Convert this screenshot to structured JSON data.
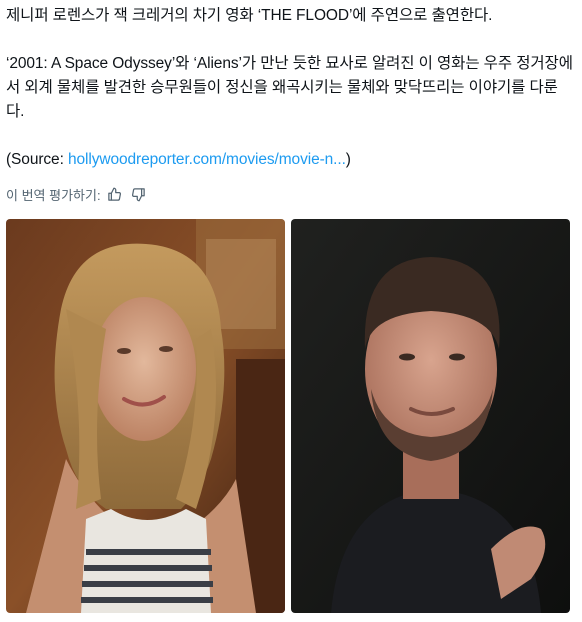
{
  "post": {
    "line1": "제니퍼 로렌스가 잭 크레거의 차기 영화 ‘THE FLOOD’에 주연으로 출연한다.",
    "line2": "‘2001: A Space Odyssey’와 ‘Aliens’가 만난 듯한 묘사로 알려진 이 영화는 우주 정거장에서 외계 물체를 발견한 승무원들이 정신을 왜곡시키는 물체와 맞닥뜨리는 이야기를 다룬다.",
    "source_prefix": "(Source: ",
    "source_link": "hollywoodreporter.com/movies/movie-n...",
    "source_suffix": ")"
  },
  "translate": {
    "label": "이 번역 평가하기:",
    "thumbs_up_icon": "thumbs-up-icon",
    "thumbs_down_icon": "thumbs-down-icon"
  },
  "media": {
    "images": [
      {
        "name": "photo-woman-blonde"
      },
      {
        "name": "photo-man-beard"
      }
    ]
  },
  "colors": {
    "text": "#0f1419",
    "link": "#1d9bf0",
    "muted": "#536471"
  }
}
